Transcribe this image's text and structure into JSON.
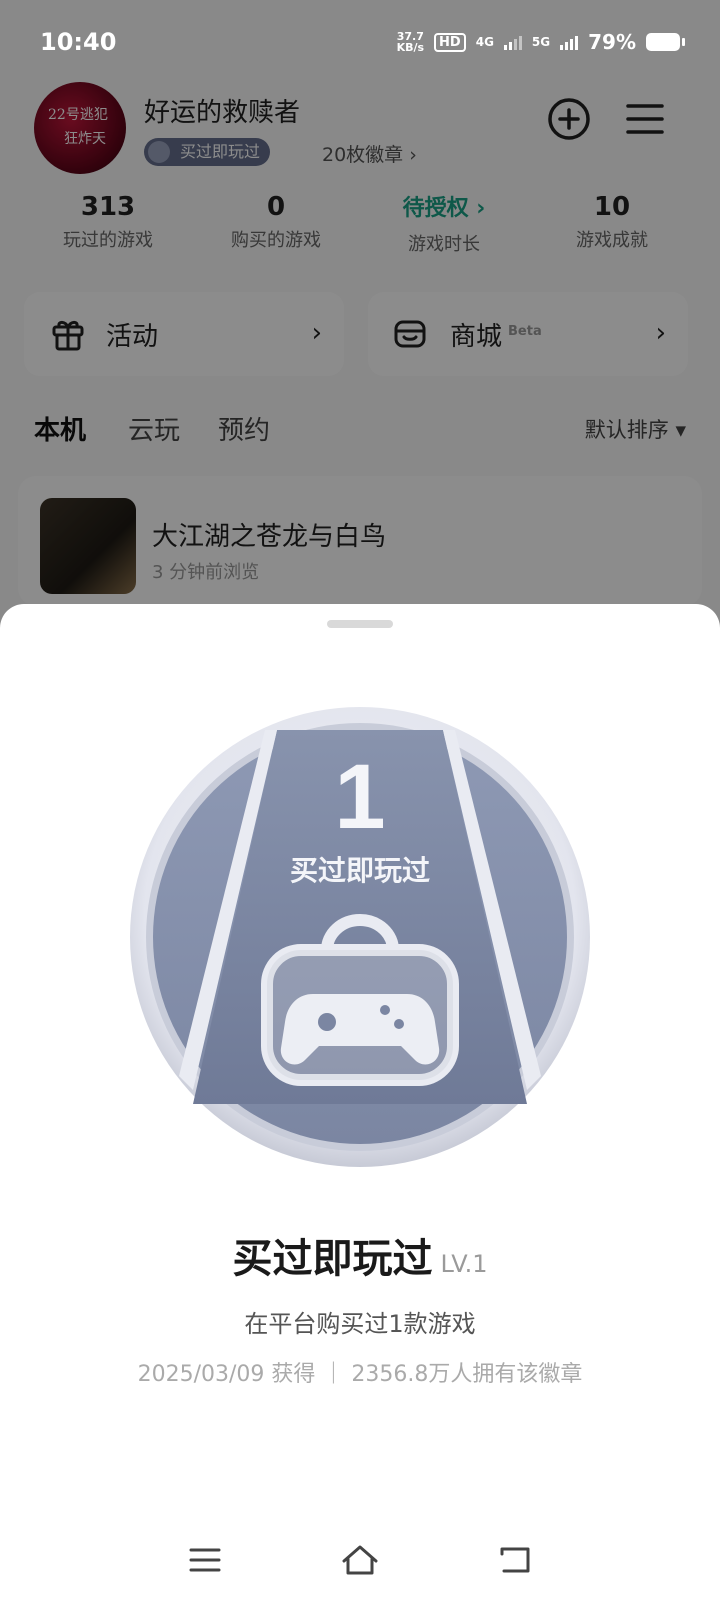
{
  "status_bar": {
    "time": "10:40",
    "net_speed_top": "37.7",
    "net_speed_bottom": "KB/s",
    "hd_label": "HD",
    "net_4g": "4G",
    "net_5g": "5G",
    "battery": "79%"
  },
  "profile": {
    "username": "好运的救赎者",
    "badge_label": "买过即玩过",
    "badge_count": "20枚徽章 ›",
    "avatar_text": [
      "22号逃犯",
      "狂炸天"
    ]
  },
  "stats": [
    {
      "value": "313",
      "label": "玩过的游戏"
    },
    {
      "value": "0",
      "label": "购买的游戏"
    },
    {
      "value": "待授权 ›",
      "label": "游戏时长"
    },
    {
      "value": "10",
      "label": "游戏成就"
    }
  ],
  "cards": {
    "activity": {
      "label": "活动",
      "chevron": "›"
    },
    "store": {
      "label": "商城",
      "superscript": "Beta",
      "chevron": "›"
    }
  },
  "tabs": {
    "local": "本机",
    "cloud": "云玩",
    "reserve": "预约",
    "sort": "默认排序 ▾"
  },
  "game": {
    "title": "大江湖之苍龙与白鸟",
    "subtitle": "3 分钟前浏览"
  },
  "sheet": {
    "medal_number": "1",
    "medal_caption": "买过即玩过",
    "title": "买过即玩过",
    "level": "LV.1",
    "description": "在平台购买过1款游戏",
    "meta": "2025/03/09 获得 ｜ 2356.8万人拥有该徽章"
  },
  "colors": {
    "accent": "#22c0a0",
    "link": "#1aa186",
    "medal_inner": "#8a95b0",
    "medal_ring": "#d9dce6"
  }
}
